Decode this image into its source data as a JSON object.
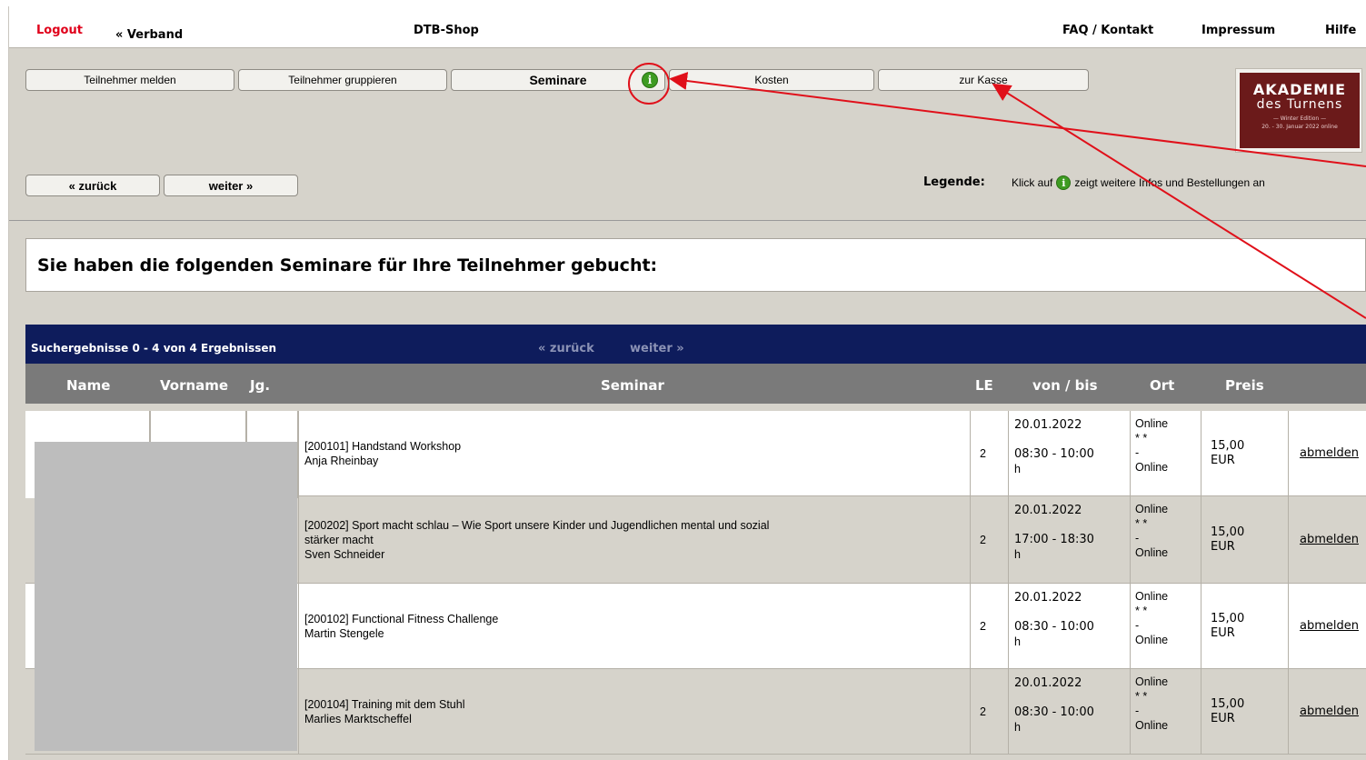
{
  "top": {
    "logout": "Logout",
    "verband": "« Verband",
    "shop": "DTB-Shop",
    "faq": "FAQ / Kontakt",
    "impressum": "Impressum",
    "hilfe": "Hilfe"
  },
  "tabs": {
    "teilnehmer_melden": "Teilnehmer melden",
    "teilnehmer_gruppieren": "Teilnehmer gruppieren",
    "seminare": "Seminare",
    "kosten": "Kosten",
    "zur_kasse": "zur Kasse",
    "info_glyph": "i"
  },
  "nav": {
    "back": "« zurück",
    "next": "weiter »"
  },
  "logo": {
    "line1": "AKADEMIE",
    "line2": "des Turnens",
    "line3": "— Winter Edition —",
    "line4": "20. - 30. Januar 2022 online"
  },
  "legend": {
    "label": "Legende:",
    "text_before": "Klick auf",
    "text_after": "zeigt weitere Infos und Bestellungen an"
  },
  "heading": "Sie haben die folgenden Seminare für Ihre Teilnehmer gebucht:",
  "results": {
    "count": "Suchergebnisse 0 - 4 von 4 Ergebnissen",
    "prev": "« zurück",
    "next": "weiter »"
  },
  "columns": {
    "name": "Name",
    "vorname": "Vorname",
    "jg": "Jg.",
    "seminar": "Seminar",
    "le": "LE",
    "von_bis": "von / bis",
    "ort": "Ort",
    "preis": "Preis"
  },
  "rows": [
    {
      "line1": "[200101] Handstand Workshop",
      "line2": "Anja Rheinbay",
      "line3": "",
      "le": "2",
      "date": "20.01.2022",
      "time": "08:30 - 10:00",
      "time_unit": "h",
      "ort1": "Online",
      "ort2": "* *",
      "ort3": "-",
      "ort4": "Online",
      "preis1": "15,00",
      "preis2": "EUR",
      "action": "abmelden"
    },
    {
      "line1": "[200202] Sport macht schlau – Wie Sport unsere Kinder und Jugendlichen mental und sozial",
      "line2": "stärker macht",
      "line3": "Sven Schneider",
      "le": "2",
      "date": "20.01.2022",
      "time": "17:00 - 18:30",
      "time_unit": "h",
      "ort1": "Online",
      "ort2": "* *",
      "ort3": "-",
      "ort4": "Online",
      "preis1": "15,00",
      "preis2": "EUR",
      "action": "abmelden"
    },
    {
      "line1": "[200102] Functional Fitness Challenge",
      "line2": "Martin Stengele",
      "line3": "",
      "le": "2",
      "date": "20.01.2022",
      "time": "08:30 - 10:00",
      "time_unit": "h",
      "ort1": "Online",
      "ort2": "* *",
      "ort3": "-",
      "ort4": "Online",
      "preis1": "15,00",
      "preis2": "EUR",
      "action": "abmelden"
    },
    {
      "line1": "[200104] Training mit dem Stuhl",
      "line2": "Marlies Marktscheffel",
      "line3": "",
      "le": "2",
      "date": "20.01.2022",
      "time": "08:30 - 10:00",
      "time_unit": "h",
      "ort1": "Online",
      "ort2": "* *",
      "ort3": "-",
      "ort4": "Online",
      "preis1": "15,00",
      "preis2": "EUR",
      "action": "abmelden"
    }
  ],
  "colors": {
    "accent_red": "#e0101a",
    "toolbar_bg": "#d6d3cb",
    "results_bar": "#0e1c5c",
    "header_gray": "#7a7a7a",
    "info_green": "#3e9b22",
    "logo_bg": "#6b1a1a"
  }
}
